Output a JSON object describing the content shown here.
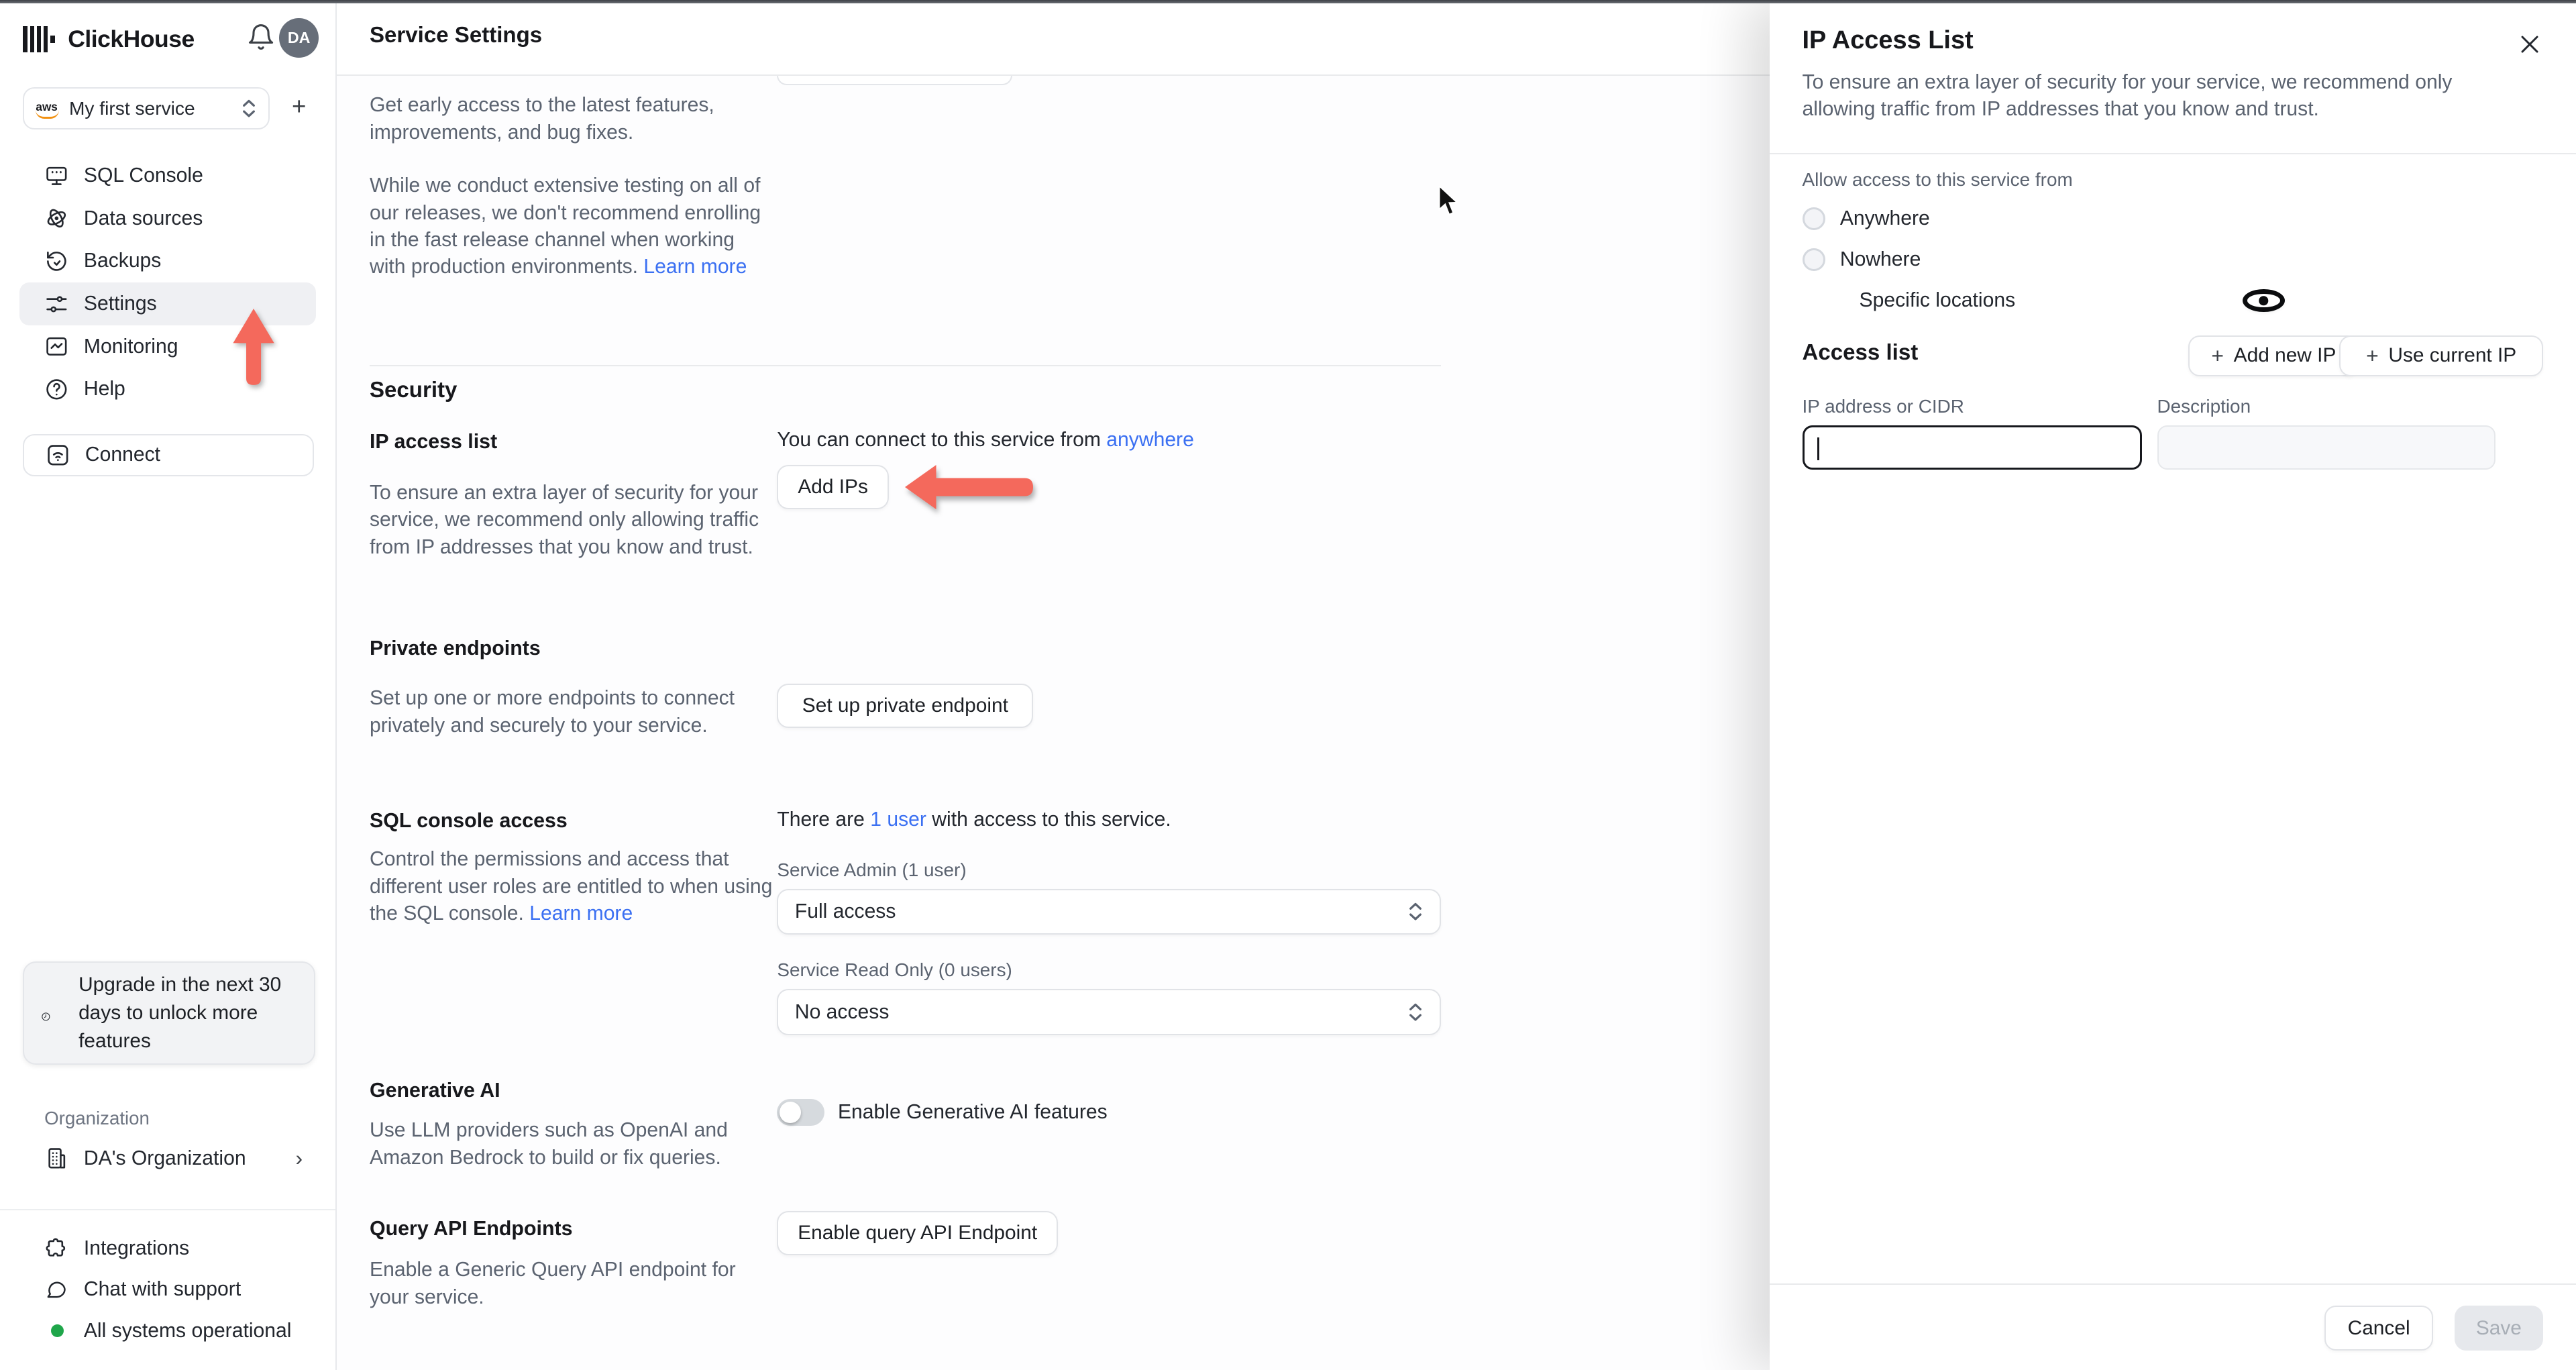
{
  "colors": {
    "link": "#3b70f2",
    "arrow": "#f4695c",
    "status_ok": "#1fa64a"
  },
  "sidebar": {
    "brand": "ClickHouse",
    "avatar_initials": "DA",
    "service_selector": {
      "provider": "aws",
      "label": "My first service"
    },
    "nav": [
      {
        "label": "SQL Console"
      },
      {
        "label": "Data sources"
      },
      {
        "label": "Backups"
      },
      {
        "label": "Settings"
      },
      {
        "label": "Monitoring"
      },
      {
        "label": "Help"
      }
    ],
    "connect_label": "Connect",
    "upgrade_notice": "Upgrade in the next 30 days to unlock more features",
    "organization_label": "Organization",
    "organization_name": "DA's Organization",
    "footer_items": [
      {
        "label": "Integrations"
      },
      {
        "label": "Chat with support"
      },
      {
        "label": "All systems operational"
      }
    ]
  },
  "header": {
    "title": "Service Settings"
  },
  "settings": {
    "fast_release": {
      "p1": "Get early access to the latest features, improvements, and bug fixes.",
      "p2": "While we conduct extensive testing on all of our releases, we don't recommend enrolling in the fast release channel when working with production environments. ",
      "learn_more": "Learn more"
    },
    "security_title": "Security",
    "ip_access": {
      "title": "IP access list",
      "desc": "To ensure an extra layer of security for your service, we recommend only allowing traffic from IP addresses that you know and trust.",
      "connect_prefix": "You can connect to this service from ",
      "connect_link": "anywhere",
      "add_ips_button": "Add IPs"
    },
    "private_endpoints": {
      "title": "Private endpoints",
      "desc": "Set up one or more endpoints to connect privately and securely to your service.",
      "button": "Set up private endpoint"
    },
    "sql_access": {
      "title": "SQL console access",
      "users_prefix": "There are ",
      "users_link": "1 user",
      "users_suffix": " with access to this service.",
      "desc": "Control the permissions and access that different user roles are entitled to when using the SQL console. ",
      "learn_more": "Learn more",
      "admin_label": "Service Admin (1 user)",
      "admin_value": "Full access",
      "readonly_label": "Service Read Only (0 users)",
      "readonly_value": "No access"
    },
    "generative_ai": {
      "title": "Generative AI",
      "desc": "Use LLM providers such as OpenAI and Amazon Bedrock to build or fix queries.",
      "toggle_label": "Enable Generative AI features",
      "toggle_on": false
    },
    "query_api": {
      "title": "Query API Endpoints",
      "desc": "Enable a Generic Query API endpoint for your service.",
      "button": "Enable query API Endpoint"
    }
  },
  "drawer": {
    "title": "IP Access List",
    "subtitle": "To ensure an extra layer of security for your service, we recommend only allowing traffic from IP addresses that you know and trust.",
    "allow_label": "Allow access to this service from",
    "options": [
      {
        "label": "Anywhere",
        "selected": false
      },
      {
        "label": "Nowhere",
        "selected": false
      },
      {
        "label": "Specific locations",
        "selected": true
      }
    ],
    "access_list_title": "Access list",
    "add_new_ip_button": "Add new IP",
    "use_current_ip_button": "Use current IP",
    "ip_field": {
      "label": "IP address or CIDR",
      "value": "",
      "focused": true
    },
    "desc_field": {
      "label": "Description",
      "value": ""
    },
    "cancel_button": "Cancel",
    "save_button": "Save"
  }
}
